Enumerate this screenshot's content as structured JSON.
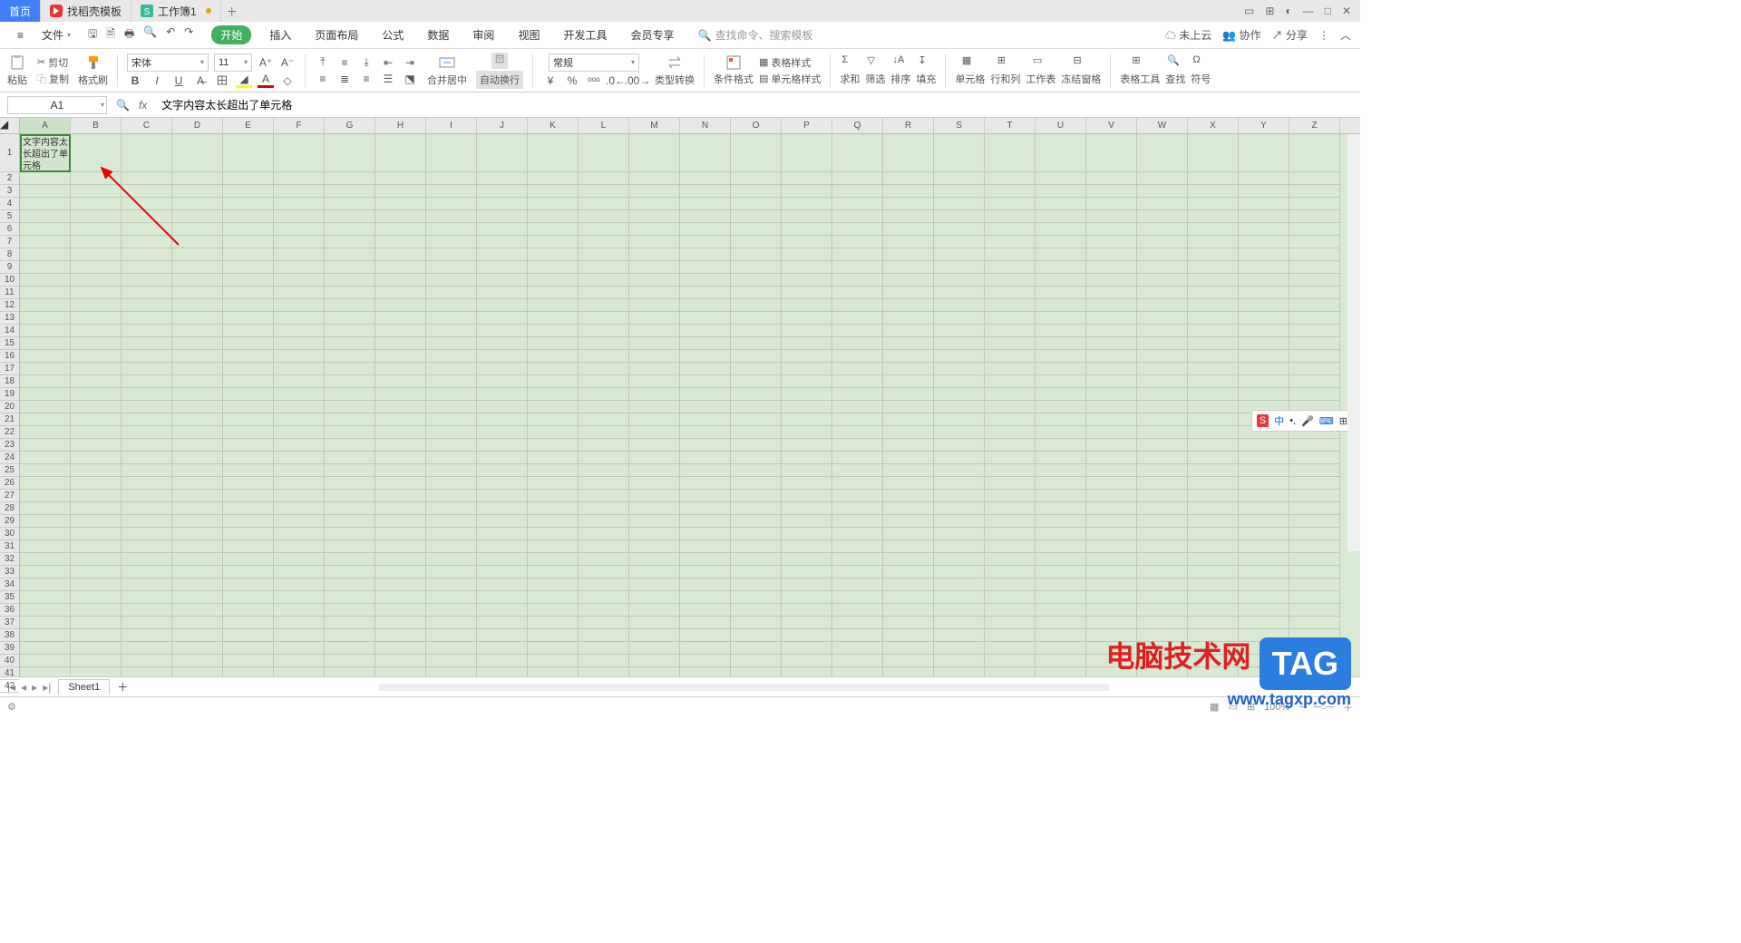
{
  "tabs": {
    "home": "首页",
    "templates": "找稻壳模板",
    "workbook": "工作簿1"
  },
  "menu": {
    "file": "文件",
    "ribbonTabs": [
      "开始",
      "插入",
      "页面布局",
      "公式",
      "数据",
      "审阅",
      "视图",
      "开发工具",
      "会员专享"
    ],
    "searchPlaceholder": "查找命令、搜索模板",
    "cloud": "未上云",
    "collab": "协作",
    "share": "分享"
  },
  "ribbon": {
    "paste": "粘贴",
    "cut": "剪切",
    "copy": "复制",
    "formatPainter": "格式刷",
    "fontName": "宋体",
    "fontSize": "11",
    "mergeCenter": "合并居中",
    "wrapText": "自动换行",
    "numberFormat": "常规",
    "typeConvert": "类型转换",
    "conditional": "条件格式",
    "cellStyle": "单元格样式",
    "tableStyle": "表格样式",
    "sum": "求和",
    "filter": "筛选",
    "sort": "排序",
    "fill": "填充",
    "cells": "单元格",
    "rowsCols": "行和列",
    "worksheet": "工作表",
    "freeze": "冻结窗格",
    "tableTools": "表格工具",
    "find": "查找",
    "symbol": "符号"
  },
  "nameBox": {
    "cell": "A1"
  },
  "formula": {
    "value": "文字内容太长超出了单元格"
  },
  "cellA1": "文字内容太长超出了单元格",
  "columns": [
    "A",
    "B",
    "C",
    "D",
    "E",
    "F",
    "G",
    "H",
    "I",
    "J",
    "K",
    "L",
    "M",
    "N",
    "O",
    "P",
    "Q",
    "R",
    "S",
    "T",
    "U",
    "V",
    "W",
    "X",
    "Y",
    "Z"
  ],
  "rows": [
    "1",
    "2",
    "3",
    "4",
    "5",
    "6",
    "7",
    "8",
    "9",
    "10",
    "11",
    "12",
    "13",
    "14",
    "15",
    "16",
    "17",
    "18",
    "19",
    "20",
    "21",
    "22",
    "23",
    "24",
    "25",
    "26",
    "27",
    "28",
    "29",
    "30",
    "31",
    "32",
    "33",
    "34",
    "35",
    "36",
    "37",
    "38",
    "39",
    "40",
    "41",
    "42"
  ],
  "sheetTab": "Sheet1",
  "status": {
    "zoom": "100%"
  },
  "ime": {
    "lang": "中"
  },
  "watermark": {
    "title": "电脑技术网",
    "url": "www.tagxp.com",
    "tag": "TAG"
  }
}
